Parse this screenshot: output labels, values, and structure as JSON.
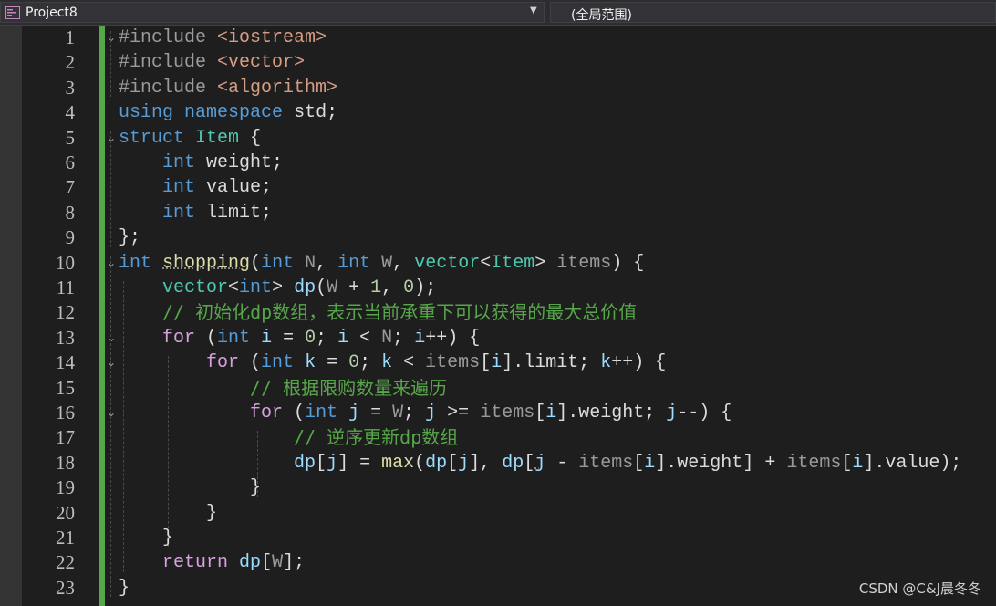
{
  "navbar": {
    "project_name": "Project8",
    "scope_label": "(全局范围)"
  },
  "line_numbers": [
    "1",
    "2",
    "3",
    "4",
    "5",
    "6",
    "7",
    "8",
    "9",
    "10",
    "11",
    "12",
    "13",
    "14",
    "15",
    "16",
    "17",
    "18",
    "19",
    "20",
    "21",
    "22",
    "23"
  ],
  "code_lines": [
    [
      {
        "t": "#include ",
        "c": "pp"
      },
      {
        "t": "<iostream>",
        "c": "inc"
      }
    ],
    [
      {
        "t": "#include ",
        "c": "pp"
      },
      {
        "t": "<vector>",
        "c": "inc"
      }
    ],
    [
      {
        "t": "#include ",
        "c": "pp"
      },
      {
        "t": "<algorithm>",
        "c": "inc"
      }
    ],
    [
      {
        "t": "using",
        "c": "kw"
      },
      {
        "t": " "
      },
      {
        "t": "namespace",
        "c": "kw"
      },
      {
        "t": " std;"
      }
    ],
    [
      {
        "t": "struct",
        "c": "kw"
      },
      {
        "t": " "
      },
      {
        "t": "Item",
        "c": "ty"
      },
      {
        "t": " {"
      }
    ],
    [
      {
        "t": "    "
      },
      {
        "t": "int",
        "c": "kw"
      },
      {
        "t": " weight;"
      }
    ],
    [
      {
        "t": "    "
      },
      {
        "t": "int",
        "c": "kw"
      },
      {
        "t": " value;"
      }
    ],
    [
      {
        "t": "    "
      },
      {
        "t": "int",
        "c": "kw"
      },
      {
        "t": " limit;"
      }
    ],
    [
      {
        "t": "};"
      }
    ],
    [
      {
        "t": "int",
        "c": "kw"
      },
      {
        "t": " "
      },
      {
        "t": "shopping",
        "c": "fn squig"
      },
      {
        "t": "("
      },
      {
        "t": "int",
        "c": "kw"
      },
      {
        "t": " "
      },
      {
        "t": "N",
        "c": "pm"
      },
      {
        "t": ", "
      },
      {
        "t": "int",
        "c": "kw"
      },
      {
        "t": " "
      },
      {
        "t": "W",
        "c": "pm"
      },
      {
        "t": ", "
      },
      {
        "t": "vector",
        "c": "ty"
      },
      {
        "t": "<"
      },
      {
        "t": "Item",
        "c": "ty"
      },
      {
        "t": "> "
      },
      {
        "t": "items",
        "c": "pm"
      },
      {
        "t": ") {"
      }
    ],
    [
      {
        "t": "    "
      },
      {
        "t": "vector",
        "c": "ty"
      },
      {
        "t": "<"
      },
      {
        "t": "int",
        "c": "kw"
      },
      {
        "t": "> "
      },
      {
        "t": "dp",
        "c": "vr"
      },
      {
        "t": "("
      },
      {
        "t": "W",
        "c": "pm"
      },
      {
        "t": " + "
      },
      {
        "t": "1",
        "c": "nm"
      },
      {
        "t": ", "
      },
      {
        "t": "0",
        "c": "nm"
      },
      {
        "t": ");"
      }
    ],
    [
      {
        "t": "    "
      },
      {
        "t": "// 初始化dp数组，表示当前承重下可以获得的最大总价值",
        "c": "cm"
      }
    ],
    [
      {
        "t": "    "
      },
      {
        "t": "for",
        "c": "ctl"
      },
      {
        "t": " ("
      },
      {
        "t": "int",
        "c": "kw"
      },
      {
        "t": " "
      },
      {
        "t": "i",
        "c": "vr"
      },
      {
        "t": " = "
      },
      {
        "t": "0",
        "c": "nm"
      },
      {
        "t": "; "
      },
      {
        "t": "i",
        "c": "vr"
      },
      {
        "t": " < "
      },
      {
        "t": "N",
        "c": "pm"
      },
      {
        "t": "; "
      },
      {
        "t": "i",
        "c": "vr"
      },
      {
        "t": "++) {"
      }
    ],
    [
      {
        "t": "        "
      },
      {
        "t": "for",
        "c": "ctl"
      },
      {
        "t": " ("
      },
      {
        "t": "int",
        "c": "kw"
      },
      {
        "t": " "
      },
      {
        "t": "k",
        "c": "vr"
      },
      {
        "t": " = "
      },
      {
        "t": "0",
        "c": "nm"
      },
      {
        "t": "; "
      },
      {
        "t": "k",
        "c": "vr"
      },
      {
        "t": " < "
      },
      {
        "t": "items",
        "c": "pm"
      },
      {
        "t": "["
      },
      {
        "t": "i",
        "c": "vr"
      },
      {
        "t": "].limit; "
      },
      {
        "t": "k",
        "c": "vr"
      },
      {
        "t": "++) {"
      }
    ],
    [
      {
        "t": "            "
      },
      {
        "t": "// 根据限购数量来遍历",
        "c": "cm"
      }
    ],
    [
      {
        "t": "            "
      },
      {
        "t": "for",
        "c": "ctl"
      },
      {
        "t": " ("
      },
      {
        "t": "int",
        "c": "kw"
      },
      {
        "t": " "
      },
      {
        "t": "j",
        "c": "vr"
      },
      {
        "t": " = "
      },
      {
        "t": "W",
        "c": "pm"
      },
      {
        "t": "; "
      },
      {
        "t": "j",
        "c": "vr"
      },
      {
        "t": " >= "
      },
      {
        "t": "items",
        "c": "pm"
      },
      {
        "t": "["
      },
      {
        "t": "i",
        "c": "vr"
      },
      {
        "t": "].weight; "
      },
      {
        "t": "j",
        "c": "vr"
      },
      {
        "t": "--) {"
      }
    ],
    [
      {
        "t": "                "
      },
      {
        "t": "// 逆序更新dp数组",
        "c": "cm"
      }
    ],
    [
      {
        "t": "                "
      },
      {
        "t": "dp",
        "c": "vr"
      },
      {
        "t": "["
      },
      {
        "t": "j",
        "c": "vr"
      },
      {
        "t": "] = "
      },
      {
        "t": "max",
        "c": "fn"
      },
      {
        "t": "("
      },
      {
        "t": "dp",
        "c": "vr"
      },
      {
        "t": "["
      },
      {
        "t": "j",
        "c": "vr"
      },
      {
        "t": "], "
      },
      {
        "t": "dp",
        "c": "vr"
      },
      {
        "t": "["
      },
      {
        "t": "j",
        "c": "vr squig"
      },
      {
        "t": " - "
      },
      {
        "t": "items",
        "c": "pm"
      },
      {
        "t": "["
      },
      {
        "t": "i",
        "c": "vr"
      },
      {
        "t": "].weight] + "
      },
      {
        "t": "items",
        "c": "pm"
      },
      {
        "t": "["
      },
      {
        "t": "i",
        "c": "vr"
      },
      {
        "t": "].value);"
      }
    ],
    [
      {
        "t": "            }"
      }
    ],
    [
      {
        "t": "        }"
      }
    ],
    [
      {
        "t": "    }"
      }
    ],
    [
      {
        "t": "    "
      },
      {
        "t": "return",
        "c": "ctl"
      },
      {
        "t": " "
      },
      {
        "t": "dp",
        "c": "vr"
      },
      {
        "t": "["
      },
      {
        "t": "W",
        "c": "pm"
      },
      {
        "t": "];"
      }
    ],
    [
      {
        "t": "}"
      }
    ]
  ],
  "fold_lines": [
    1,
    5,
    10,
    13,
    14,
    16
  ],
  "watermark": "CSDN @C&J晨冬冬"
}
